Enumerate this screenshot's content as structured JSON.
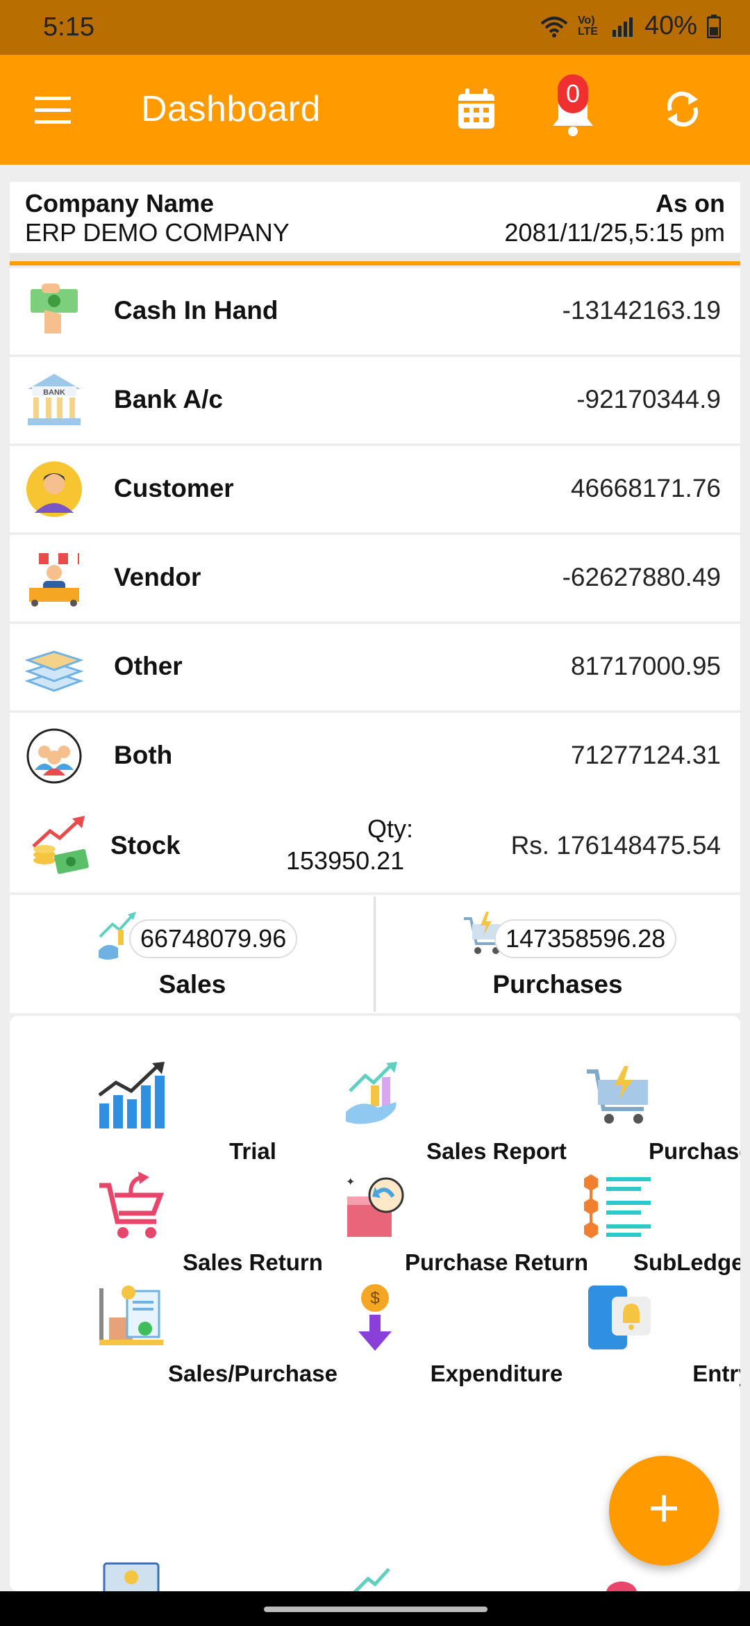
{
  "status_bar": {
    "time": "5:15",
    "network": "Vo) LTE",
    "battery": "40%"
  },
  "app_bar": {
    "title": "Dashboard",
    "notification_count": "0"
  },
  "company": {
    "name_label": "Company Name",
    "name": "ERP DEMO COMPANY",
    "as_on_label": "As on",
    "as_on": "2081/11/25,5:15 pm"
  },
  "balances": [
    {
      "label": "Cash In Hand",
      "amount": "-13142163.19",
      "icon": "cash-in-hand-icon"
    },
    {
      "label": "Bank A/c",
      "amount": "-92170344.9",
      "icon": "bank-icon"
    },
    {
      "label": "Customer",
      "amount": "46668171.76",
      "icon": "customer-icon"
    },
    {
      "label": "Vendor",
      "amount": "-62627880.49",
      "icon": "vendor-icon"
    },
    {
      "label": "Other",
      "amount": "81717000.95",
      "icon": "layers-icon"
    },
    {
      "label": "Both",
      "amount": "71277124.31",
      "icon": "group-icon"
    }
  ],
  "stock": {
    "label": "Stock",
    "qty_label": "Qty:",
    "qty": "153950.21",
    "amount": "Rs. 176148475.54"
  },
  "totals": {
    "sales": {
      "label": "Sales",
      "value": "66748079.96"
    },
    "purchases": {
      "label": "Purchases",
      "value": "147358596.28"
    }
  },
  "menu": [
    {
      "label": "Trial",
      "icon": "trial-chart-icon"
    },
    {
      "label": "Sales Report",
      "icon": "sales-report-icon"
    },
    {
      "label": "Purchase Report",
      "icon": "purchase-report-cart-icon"
    },
    {
      "label": "Sales Return",
      "icon": "sales-return-cart-icon"
    },
    {
      "label": "Purchase Return",
      "icon": "purchase-return-box-icon"
    },
    {
      "label": "SubLedger Balance",
      "icon": "subledger-list-icon"
    },
    {
      "label": "Sales/Purchase",
      "icon": "sales-purchase-trolley-icon"
    },
    {
      "label": "Expenditure",
      "icon": "expenditure-coin-icon"
    },
    {
      "label": "Entry No",
      "icon": "entry-notification-phone-icon"
    }
  ],
  "colors": {
    "primary": "#ff9a00",
    "status_bar": "#b86e00",
    "badge": "#f03030"
  }
}
